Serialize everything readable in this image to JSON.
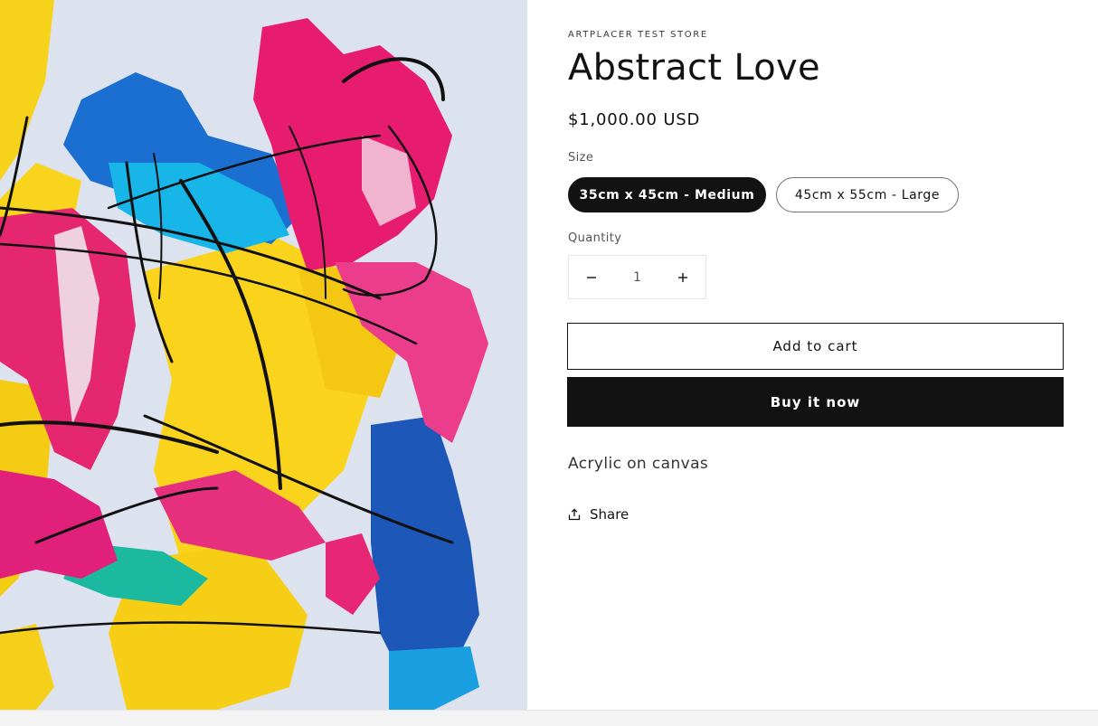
{
  "product": {
    "vendor": "ARTPLACER TEST STORE",
    "title": "Abstract Love",
    "price": "$1,000.00 USD",
    "description": "Acrylic on canvas",
    "image_icon": "abstract-painting-image"
  },
  "size": {
    "label": "Size",
    "options": [
      "35cm x 45cm - Medium",
      "45cm x 55cm - Large"
    ],
    "selected": "35cm x 45cm - Medium"
  },
  "quantity": {
    "label": "Quantity",
    "value": "1",
    "decrease_icon": "minus-icon",
    "increase_icon": "plus-icon"
  },
  "buttons": {
    "add_to_cart": "Add to cart",
    "buy_now": "Buy it now"
  },
  "share": {
    "label": "Share",
    "icon": "share-icon"
  },
  "colors": {
    "primary": "#121212",
    "background": "#ffffff"
  }
}
